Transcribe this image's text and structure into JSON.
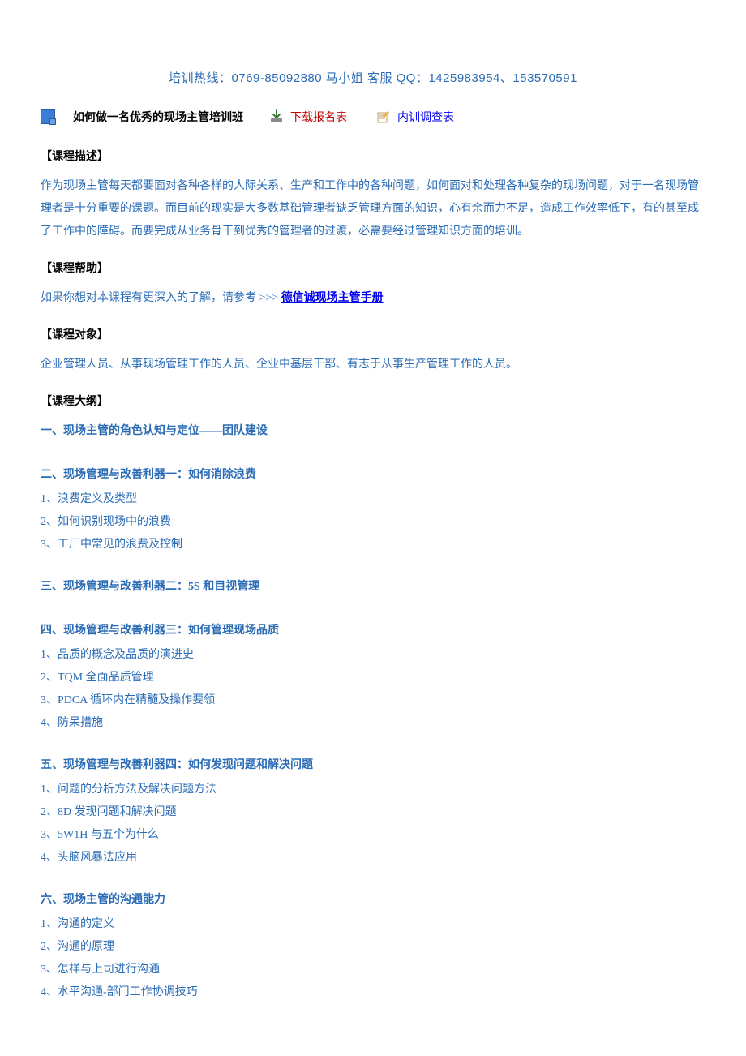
{
  "hotline": "培训热线：0769-85092880 马小姐  客服 QQ：1425983954、153570591",
  "titleRow": {
    "title": "如何做一名优秀的现场主管培训班",
    "download": "下载报名表",
    "survey": "内训调查表"
  },
  "sections": {
    "desc": {
      "head": "【课程描述】",
      "body": "作为现场主管每天都要面对各种各样的人际关系、生产和工作中的各种问题，如何面对和处理各种复杂的现场问题，对于一名现场管理者是十分重要的课题。而目前的现实是大多数基础管理者缺乏管理方面的知识，心有余而力不足，造成工作效率低下，有的甚至成了工作中的障碍。而要完成从业务骨干到优秀的管理者的过渡，必需要经过管理知识方面的培训。"
    },
    "help": {
      "head": "【课程帮助】",
      "prefix": "如果你想对本课程有更深入的了解，请参考 >>> ",
      "link": "德信诚现场主管手册"
    },
    "target": {
      "head": "【课程对象】",
      "body": "企业管理人员、从事现场管理工作的人员、企业中基层干部、有志于从事生产管理工作的人员。"
    },
    "outline": {
      "head": "【课程大纲】",
      "s1": {
        "title": "一、现场主管的角色认知与定位——团队建设"
      },
      "s2": {
        "title": "二、现场管理与改善利器一：如何消除浪费",
        "items": [
          "1、浪费定义及类型",
          "2、如何识别现场中的浪费",
          "3、工厂中常见的浪费及控制"
        ]
      },
      "s3": {
        "title": "三、现场管理与改善利器二：5S 和目视管理"
      },
      "s4": {
        "title": "四、现场管理与改善利器三：如何管理现场品质",
        "items": [
          "1、品质的概念及品质的演进史",
          "2、TQM 全面品质管理",
          "3、PDCA 循环内在精髓及操作要领",
          "4、防呆措施"
        ]
      },
      "s5": {
        "title": "五、现场管理与改善利器四：如何发现问题和解决问题",
        "items": [
          "1、问题的分析方法及解决问题方法",
          "2、8D 发现问题和解决问题",
          "3、5W1H 与五个为什么",
          "4、头脑风暴法应用"
        ]
      },
      "s6": {
        "title": "六、现场主管的沟通能力",
        "items": [
          "1、沟通的定义",
          "2、沟通的原理",
          "3、怎样与上司进行沟通",
          "4、水平沟通-部门工作协调技巧"
        ]
      }
    }
  }
}
